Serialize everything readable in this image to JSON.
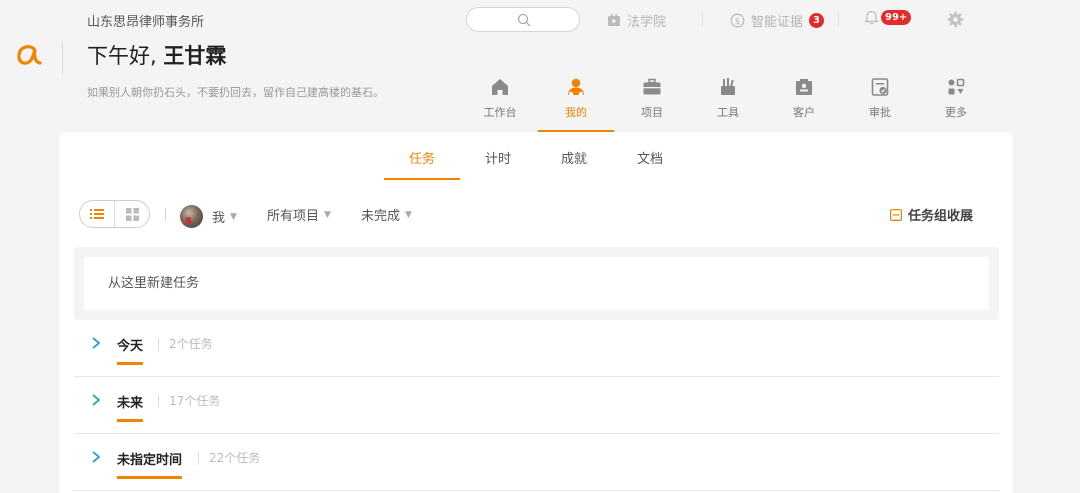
{
  "header": {
    "firm_name": "山东思昂律师事务所",
    "greeting_prefix": "下午好, ",
    "user_name": "王甘霖",
    "motto": "如果别人朝你扔石头，不要扔回去，留作自己建高楼的基石。"
  },
  "search": {
    "placeholder": ""
  },
  "toplinks": {
    "academy": "法学院",
    "evidence": "智能证据",
    "evidence_badge": "3",
    "notification_badge": "99+"
  },
  "nav": [
    {
      "label": "工作台",
      "icon": "home-icon"
    },
    {
      "label": "我的",
      "icon": "person-icon",
      "active": true
    },
    {
      "label": "项目",
      "icon": "briefcase-icon"
    },
    {
      "label": "工具",
      "icon": "tools-icon"
    },
    {
      "label": "客户",
      "icon": "client-icon"
    },
    {
      "label": "审批",
      "icon": "approval-icon"
    },
    {
      "label": "更多",
      "icon": "more-icon"
    }
  ],
  "tabs": [
    {
      "label": "任务",
      "active": true
    },
    {
      "label": "计时"
    },
    {
      "label": "成就"
    },
    {
      "label": "文档"
    }
  ],
  "filters": {
    "assignee": "我",
    "project": "所有项目",
    "status": "未完成",
    "collapse_label": "任务组收展"
  },
  "new_task": {
    "placeholder": "从这里新建任务"
  },
  "groups": [
    {
      "name": "今天",
      "count": "2个任务"
    },
    {
      "name": "未来",
      "count": "17个任务"
    },
    {
      "name": "未指定时间",
      "count": "22个任务"
    }
  ],
  "colors": {
    "accent": "#f08300",
    "badge": "#e52a2a",
    "chevron": "#29a3c7"
  }
}
